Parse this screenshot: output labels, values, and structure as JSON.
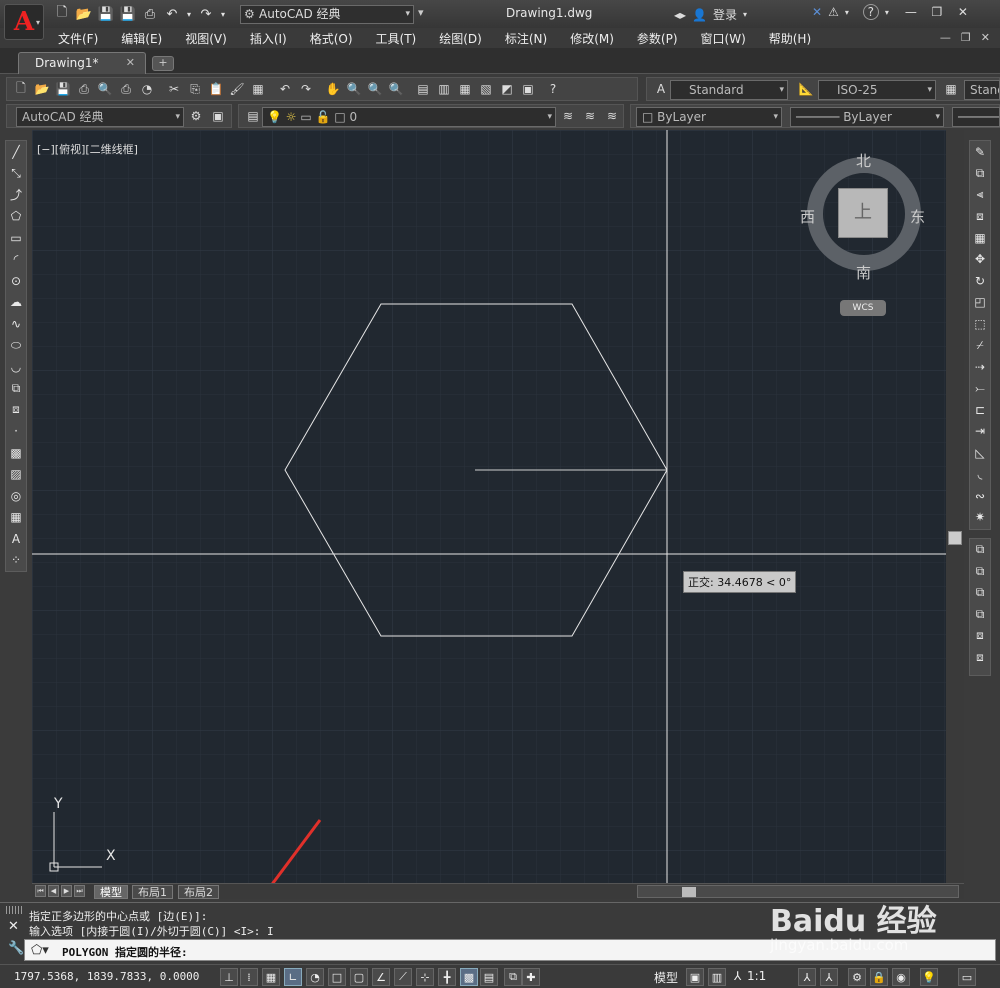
{
  "title_bar": {
    "app_logo": "A",
    "workspace": "AutoCAD 经典",
    "document_title": "Drawing1.dwg",
    "signin_label": "登录",
    "help_label": "?"
  },
  "menu": {
    "items": [
      "文件(F)",
      "编辑(E)",
      "视图(V)",
      "插入(I)",
      "格式(O)",
      "工具(T)",
      "绘图(D)",
      "标注(N)",
      "修改(M)",
      "参数(P)",
      "窗口(W)",
      "帮助(H)"
    ]
  },
  "tabs": {
    "document_tab": "Drawing1*",
    "new_tab_label": "+"
  },
  "toolbar": {
    "text_style": "Standard",
    "dim_style": "ISO-25",
    "table_style": "Stand",
    "workspace_combo": "AutoCAD 经典",
    "layer_name": "0",
    "color": "ByLayer",
    "linetype": "ByLayer"
  },
  "viewport": {
    "label": "[−][俯视][二维线框]",
    "compass_north": "北",
    "compass_south": "南",
    "compass_east": "东",
    "compass_west": "西",
    "viewcube_face": "上",
    "wcs_label": "WCS",
    "ucs_y": "Y",
    "ucs_x": "X",
    "tooltip": "正交: 34.4678 < 0°"
  },
  "layout_tabs": [
    "模型",
    "布局1",
    "布局2"
  ],
  "command": {
    "history_1": "指定正多边形的中心点或 [边(E)]:",
    "history_2": "输入选项 [内接于圆(I)/外切于圆(C)] <I>: I",
    "prompt": "POLYGON 指定圆的半径:"
  },
  "status": {
    "coordinates": "1797.5368, 1839.7833, 0.0000",
    "model_label": "模型",
    "scale_label": "1:1"
  },
  "watermark": {
    "brand": "Baidu 经验",
    "url": "jingyan.baidu.com"
  },
  "colors": {
    "canvas": "#212830",
    "geometry": "#e6e6e6",
    "arrow": "#e0302a"
  }
}
